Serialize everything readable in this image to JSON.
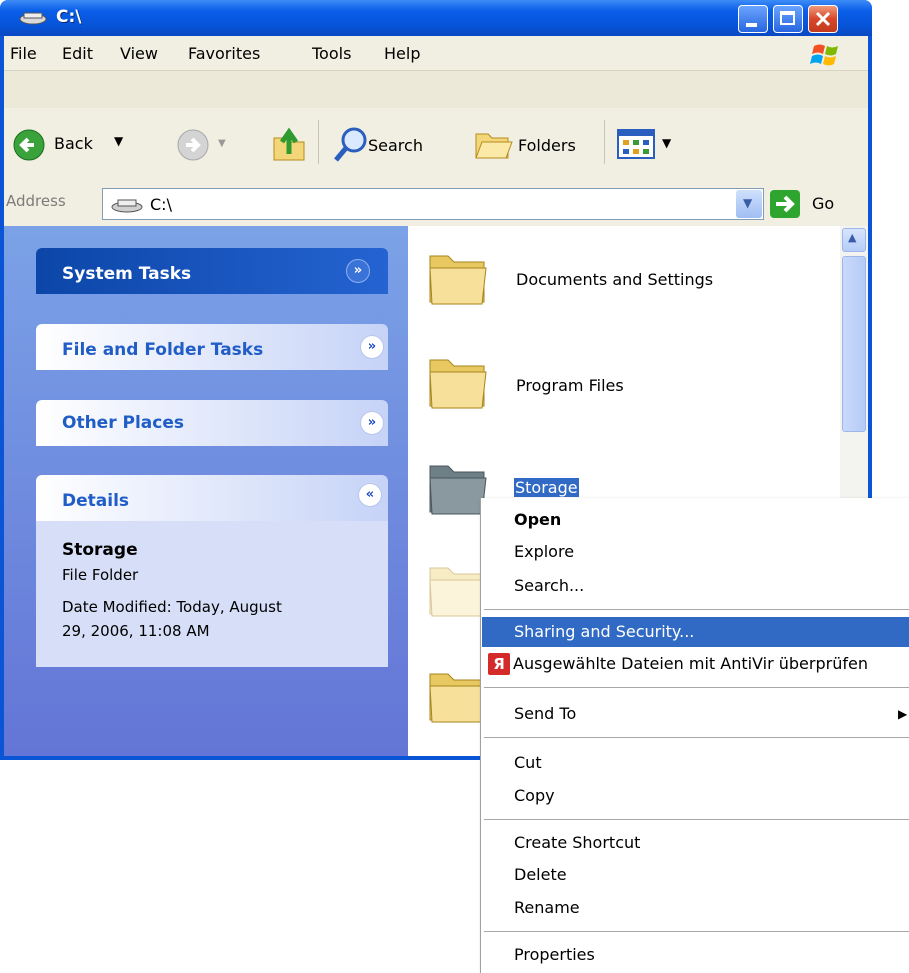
{
  "window": {
    "title": "C:\\"
  },
  "menubar": {
    "items": [
      "File",
      "Edit",
      "View",
      "Favorites",
      "Tools",
      "Help"
    ]
  },
  "toolbar": {
    "back": "Back",
    "search": "Search",
    "folders": "Folders"
  },
  "address": {
    "label": "Address",
    "value": "C:\\",
    "go": "Go"
  },
  "taskpane": {
    "system_tasks": "System Tasks",
    "file_folder_tasks": "File and Folder Tasks",
    "other_places": "Other Places",
    "details": {
      "title": "Details",
      "name": "Storage",
      "type": "File Folder",
      "modified_line1": "Date Modified: Today, August",
      "modified_line2": "29, 2006, 11:08 AM"
    }
  },
  "files": [
    "Documents and Settings",
    "Program Files",
    "Storage"
  ],
  "context_menu": {
    "open": "Open",
    "explore": "Explore",
    "search": "Search...",
    "sharing": "Sharing and Security...",
    "antivir": "Ausgewählte Dateien mit AntiVir überprüfen",
    "send_to": "Send To",
    "cut": "Cut",
    "copy": "Copy",
    "create_shortcut": "Create Shortcut",
    "delete": "Delete",
    "rename": "Rename",
    "properties": "Properties"
  },
  "colors": {
    "titlebar": "#0a5ee8",
    "taskpane": "#6f8fe0",
    "selection": "#316ac5"
  }
}
